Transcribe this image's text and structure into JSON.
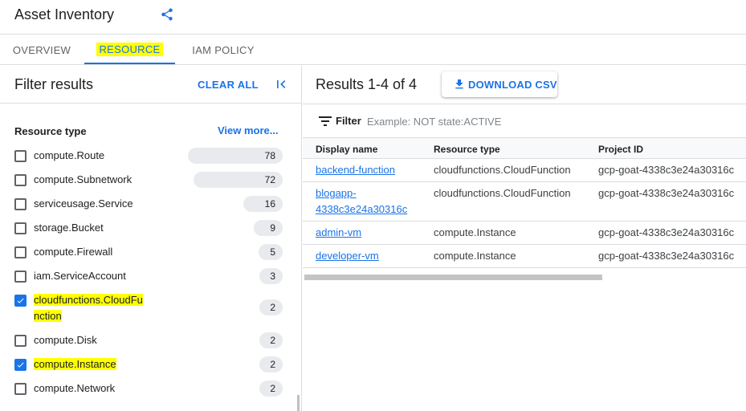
{
  "header": {
    "title": "Asset Inventory",
    "share_icon": "share-icon"
  },
  "tabs": [
    {
      "label": "OVERVIEW",
      "active": false
    },
    {
      "label": "RESOURCE",
      "active": true,
      "highlighted": true
    },
    {
      "label": "IAM POLICY",
      "active": false
    }
  ],
  "filter_panel": {
    "title": "Filter results",
    "clear_all": "CLEAR ALL",
    "collapse_icon": "collapse-left-icon",
    "resource_type_label": "Resource type",
    "view_more": "View more...",
    "facets": [
      {
        "label": "compute.Route",
        "count": "78",
        "checked": false,
        "highlighted": false
      },
      {
        "label": "compute.Subnetwork",
        "count": "72",
        "checked": false,
        "highlighted": false
      },
      {
        "label": "serviceusage.Service",
        "count": "16",
        "checked": false,
        "highlighted": false
      },
      {
        "label": "storage.Bucket",
        "count": "9",
        "checked": false,
        "highlighted": false
      },
      {
        "label": "compute.Firewall",
        "count": "5",
        "checked": false,
        "highlighted": false
      },
      {
        "label": "iam.ServiceAccount",
        "count": "3",
        "checked": false,
        "highlighted": false
      },
      {
        "label": "cloudfunctions.CloudFunction",
        "label_line1": "cloudfunctions.CloudFu",
        "label_line2": "nction",
        "count": "2",
        "checked": true,
        "highlighted": true
      },
      {
        "label": "compute.Disk",
        "count": "2",
        "checked": false,
        "highlighted": false
      },
      {
        "label": "compute.Instance",
        "count": "2",
        "checked": true,
        "highlighted": true
      },
      {
        "label": "compute.Network",
        "count": "2",
        "checked": false,
        "highlighted": false
      }
    ]
  },
  "results": {
    "title": "Results 1-4 of 4",
    "download_label": "DOWNLOAD CSV",
    "filter_label": "Filter",
    "filter_placeholder": "Example: NOT state:ACTIVE",
    "columns": [
      "Display name",
      "Resource type",
      "Project ID"
    ],
    "rows": [
      {
        "name": "backend-function",
        "type": "cloudfunctions.CloudFunction",
        "project": "gcp-goat-4338c3e24a30316c"
      },
      {
        "name": "blogapp-4338c3e24a30316c",
        "name_line1": "blogapp-",
        "name_line2": "4338c3e24a30316c",
        "type": "cloudfunctions.CloudFunction",
        "project": "gcp-goat-4338c3e24a30316c"
      },
      {
        "name": "admin-vm",
        "type": "compute.Instance",
        "project": "gcp-goat-4338c3e24a30316c"
      },
      {
        "name": "developer-vm",
        "type": "compute.Instance",
        "project": "gcp-goat-4338c3e24a30316c"
      }
    ]
  },
  "colors": {
    "accent": "#1a73e8",
    "highlight": "#ffff00",
    "divider": "#dadce0"
  }
}
